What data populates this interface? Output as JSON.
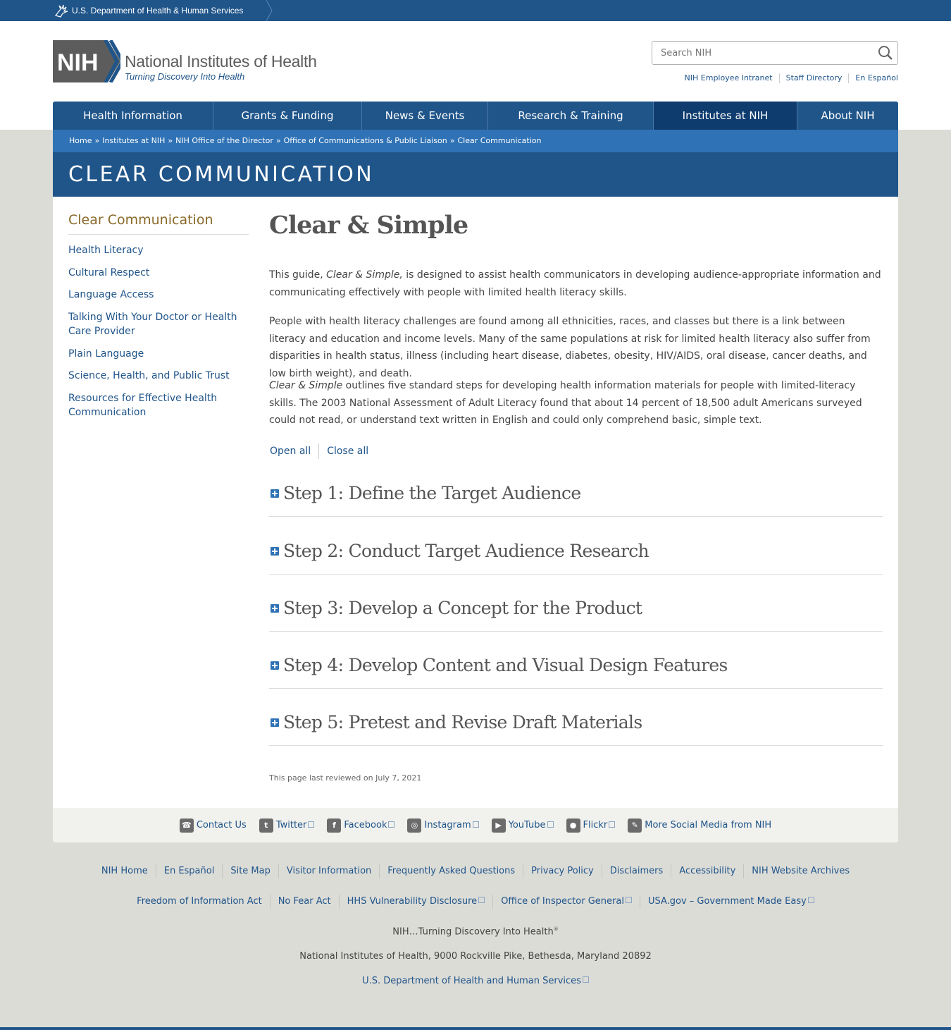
{
  "hhs_bar": {
    "label": "U.S. Department of Health & Human Services"
  },
  "header": {
    "logo_text": "NIH",
    "title": "National Institutes of Health",
    "tagline": "Turning Discovery Into Health",
    "search_placeholder": "Search NIH",
    "util_links": [
      "NIH Employee Intranet",
      "Staff Directory",
      "En Español"
    ]
  },
  "nav": {
    "items": [
      {
        "label": "Health Information"
      },
      {
        "label": "Grants & Funding"
      },
      {
        "label": "News & Events"
      },
      {
        "label": "Research & Training"
      },
      {
        "label": "Institutes at NIH",
        "active": true
      },
      {
        "label": "About NIH"
      }
    ]
  },
  "breadcrumb": [
    "Home",
    "Institutes at NIH",
    "NIH Office of the Director",
    "Office of Communications & Public Liaison",
    "Clear Communication"
  ],
  "section_title": "CLEAR COMMUNICATION",
  "sidebar": {
    "title": "Clear Communication",
    "items": [
      "Health Literacy",
      "Cultural Respect",
      "Language Access",
      "Talking With Your Doctor or Health Care Provider",
      "Plain Language",
      "Science, Health, and Public Trust",
      "Resources for Effective Health Communication"
    ]
  },
  "main": {
    "title": "Clear & Simple",
    "p1_a": "This guide, ",
    "p1_em": "Clear & Simple,",
    "p1_b": " is designed to assist health communicators in developing audience-appropriate information and communicating effectively with people with limited health literacy skills.",
    "p2": "People with health literacy challenges are found among all ethnicities, races, and classes but there is a link between literacy and education and income levels. Many of the same populations at risk for limited health literacy also suffer from disparities in health status, illness (including heart disease, diabetes, obesity, HIV/AIDS, oral disease, cancer deaths, and low birth weight), and death.",
    "p3_em": "Clear & Simple",
    "p3_b": " outlines five standard steps for developing health information materials for people with limited-literacy skills. The 2003 National Assessment of Adult Literacy found that about 14 percent of 18,500 adult Americans surveyed could not read, or understand text written in English and could only comprehend basic, simple text.",
    "open_all": "Open all",
    "close_all": "Close all",
    "steps": [
      "Step 1: Define the Target Audience",
      "Step 2: Conduct Target Audience Research",
      "Step 3: Develop a Concept for the Product",
      "Step 4: Develop Content and Visual Design Features",
      "Step 5: Pretest and Revise Draft Materials"
    ],
    "reviewed": "This page last reviewed on July 7, 2021"
  },
  "social": [
    {
      "label": "Contact Us",
      "icon": "phone-icon",
      "glyph": "☎"
    },
    {
      "label": "Twitter",
      "icon": "twitter-icon",
      "glyph": "t"
    },
    {
      "label": "Facebook",
      "icon": "facebook-icon",
      "glyph": "f"
    },
    {
      "label": "Instagram",
      "icon": "instagram-icon",
      "glyph": "◎"
    },
    {
      "label": "YouTube",
      "icon": "youtube-icon",
      "glyph": "▶"
    },
    {
      "label": "Flickr",
      "icon": "flickr-icon",
      "glyph": "●"
    },
    {
      "label": "More Social Media from NIH",
      "icon": "chat-icon",
      "glyph": "✎"
    }
  ],
  "footer": {
    "row1": [
      "NIH Home",
      "En Español",
      "Site Map",
      "Visitor Information",
      "Frequently Asked Questions",
      "Privacy Policy",
      "Disclaimers",
      "Accessibility",
      "NIH Website Archives"
    ],
    "row2": [
      "Freedom of Information Act",
      "No Fear Act",
      "HHS Vulnerability Disclosure",
      "Office of Inspector General",
      "USA.gov – Government Made Easy"
    ],
    "tagline": "NIH…Turning Discovery Into Health",
    "tagline_mark": "®",
    "address": "National Institutes of Health, 9000 Rockville Pike, Bethesda, Maryland 20892",
    "hhs_link": "U.S. Department of Health and Human Services"
  },
  "colors": {
    "primary": "#20558a",
    "breadcrumb": "#2f72b5",
    "active_nav": "#0e3c6e",
    "sidebar_title": "#8a6a2a"
  }
}
